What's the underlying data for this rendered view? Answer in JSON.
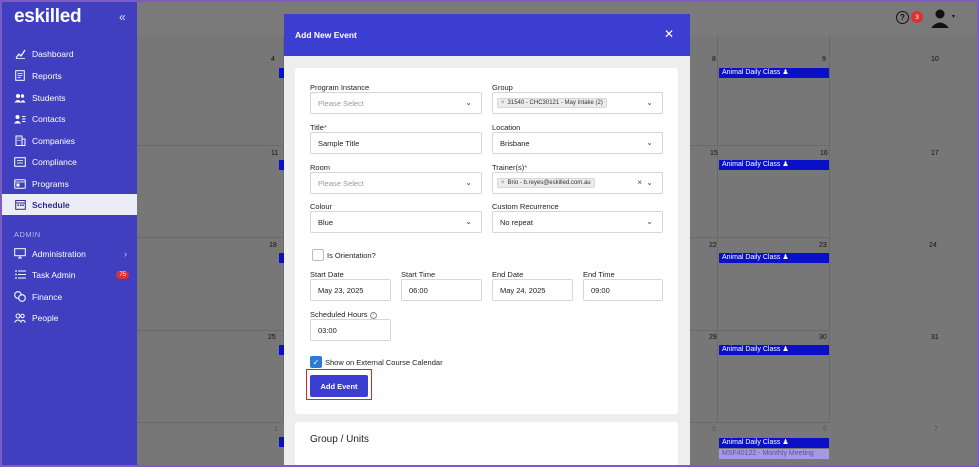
{
  "brand": {
    "logo": "eskilled",
    "collapse": "«"
  },
  "sidebar": {
    "items": [
      {
        "label": "Dashboard"
      },
      {
        "label": "Reports"
      },
      {
        "label": "Students"
      },
      {
        "label": "Contacts"
      },
      {
        "label": "Companies"
      },
      {
        "label": "Compliance"
      },
      {
        "label": "Programs"
      },
      {
        "label": "Schedule"
      }
    ],
    "admin_label": "ADMIN",
    "admin_items": [
      {
        "label": "Administration"
      },
      {
        "label": "Task Admin",
        "badge": "75"
      },
      {
        "label": "Finance"
      },
      {
        "label": "People"
      }
    ]
  },
  "header": {
    "help": "?",
    "notifications": "3"
  },
  "calendar": {
    "rows": [
      {
        "days": [
          "4",
          "8",
          "9",
          "10"
        ]
      },
      {
        "days": [
          "11",
          "15",
          "16",
          "17"
        ]
      },
      {
        "days": [
          "18",
          "22",
          "23",
          "24"
        ]
      },
      {
        "days": [
          "25",
          "29",
          "30",
          "31"
        ]
      },
      {
        "days": [
          "1",
          "5",
          "6",
          "7"
        ]
      }
    ],
    "event_label": "Animal Daily Class",
    "event_label_2": "MSF40122 - Monthly Meeting"
  },
  "modal": {
    "title": "Add New Event",
    "close": "✕",
    "fields": {
      "program_instance": {
        "label": "Program Instance",
        "placeholder": "Please Select"
      },
      "group": {
        "label": "Group",
        "chip": "31540 - CHC30121 - May Intake (2)"
      },
      "title": {
        "label": "Title",
        "value": "Sample Title"
      },
      "location": {
        "label": "Location",
        "value": "Brisbane"
      },
      "room": {
        "label": "Room",
        "placeholder": "Please Select"
      },
      "trainers": {
        "label": "Trainer(s)",
        "chip": "Brio - b.reyes@eskilled.com.au"
      },
      "colour": {
        "label": "Colour",
        "value": "Blue"
      },
      "custom_recurrence": {
        "label": "Custom Recurrence",
        "value": "No repeat"
      },
      "is_orientation": {
        "label": "Is Orientation?"
      },
      "start_date": {
        "label": "Start Date",
        "value": "May 23, 2025"
      },
      "start_time": {
        "label": "Start Time",
        "value": "06:00"
      },
      "end_date": {
        "label": "End Date",
        "value": "May 24, 2025"
      },
      "end_time": {
        "label": "End Time",
        "value": "09:00"
      },
      "scheduled_hours": {
        "label": "Scheduled Hours",
        "value": "03:00"
      },
      "show_external": {
        "label": "Show on External Course Calendar"
      }
    },
    "submit_label": "Add Event",
    "section2_title": "Group / Units"
  }
}
